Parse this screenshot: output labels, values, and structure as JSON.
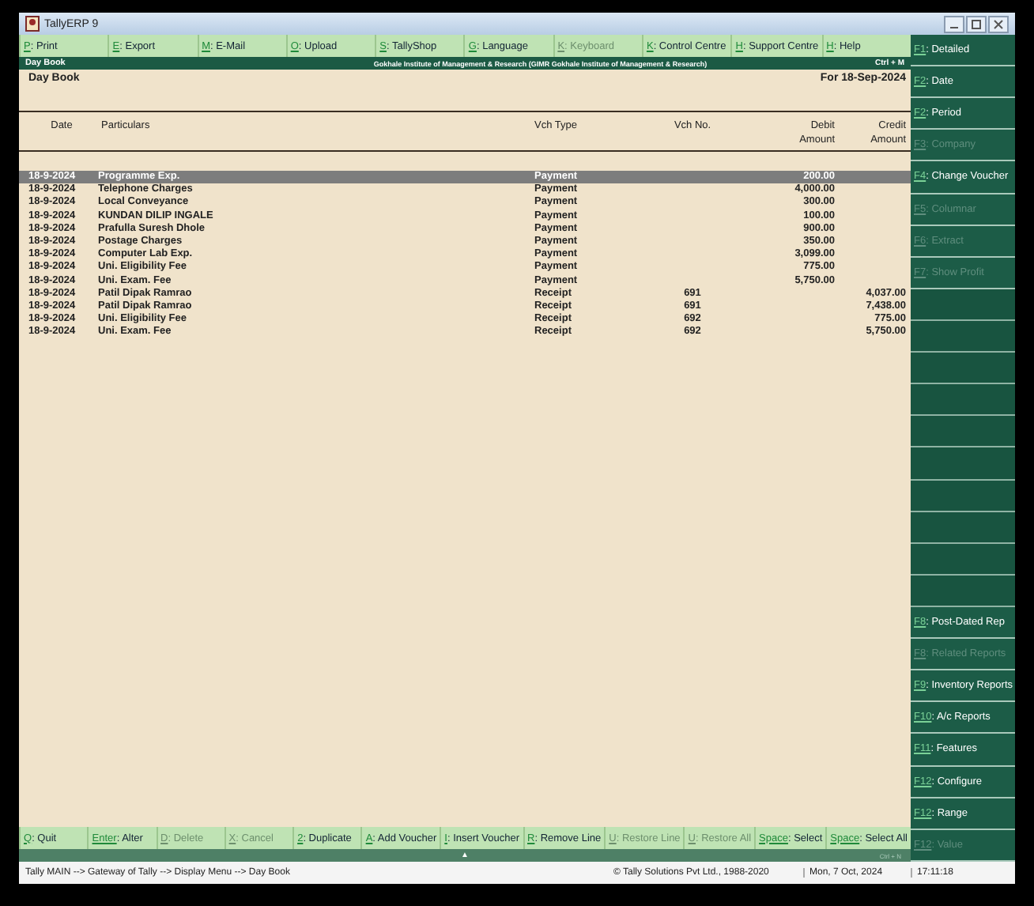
{
  "window": {
    "title": "TallyERP 9"
  },
  "top_buttons": [
    {
      "key": "P",
      "label": ": Print",
      "disabled": false
    },
    {
      "key": "E",
      "label": ": Export",
      "disabled": false
    },
    {
      "key": "M",
      "label": ": E-Mail",
      "disabled": false
    },
    {
      "key": "O",
      "label": ": Upload",
      "disabled": false
    },
    {
      "key": "S",
      "label": ": TallyShop",
      "disabled": false
    },
    {
      "key": "G",
      "label": ": Language",
      "disabled": false
    },
    {
      "key": "K",
      "label": ": Keyboard",
      "disabled": true
    },
    {
      "key": "K",
      "label": ": Control Centre",
      "disabled": false
    },
    {
      "key": "H",
      "label": ": Support Centre",
      "disabled": false
    },
    {
      "key": "H",
      "label": ": Help",
      "disabled": false
    }
  ],
  "header_bar": {
    "screen": "Day Book",
    "company": "Gokhale Institute of Management & Research (GIMR Gokhale Institute of Management & Research)",
    "shortcut": "Ctrl + M"
  },
  "report": {
    "title": "Day Book",
    "period": "For 18-Sep-2024"
  },
  "table": {
    "columns": [
      {
        "label": "Date"
      },
      {
        "label": "Particulars"
      },
      {
        "label": "Vch Type"
      },
      {
        "label": "Vch No."
      },
      {
        "label": "Debit",
        "sub": "Amount"
      },
      {
        "label": "Credit",
        "sub": "Amount"
      }
    ],
    "rows": [
      {
        "date": "18-9-2024",
        "particulars": "Programme Exp.",
        "vch_type": "Payment",
        "debit": "200.00",
        "selected": true
      },
      {
        "date": "18-9-2024",
        "particulars": "Telephone Charges",
        "vch_type": "Payment",
        "debit": "4,000.00",
        "selected": false
      },
      {
        "date": "18-9-2024",
        "particulars": "Local Conveyance",
        "vch_type": "Payment",
        "debit": "300.00",
        "selected": false
      },
      {
        "date": "18-9-2024",
        "particulars": "KUNDAN DILIP INGALE",
        "vch_type": "Payment",
        "debit": "100.00",
        "selected": false
      },
      {
        "date": "18-9-2024",
        "particulars": "Prafulla Suresh Dhole",
        "vch_type": "Payment",
        "debit": "900.00",
        "selected": false
      },
      {
        "date": "18-9-2024",
        "particulars": "Postage Charges",
        "vch_type": "Payment",
        "debit": "350.00",
        "selected": false
      },
      {
        "date": "18-9-2024",
        "particulars": "Computer Lab Exp.",
        "vch_type": "Payment",
        "debit": "3,099.00",
        "selected": false
      },
      {
        "date": "18-9-2024",
        "particulars": "Uni. Eligibility Fee",
        "vch_type": "Payment",
        "debit": "775.00",
        "selected": false
      },
      {
        "date": "18-9-2024",
        "particulars": "Uni. Exam. Fee",
        "vch_type": "Payment",
        "debit": "5,750.00",
        "selected": false
      },
      {
        "date": "18-9-2024",
        "particulars": "Patil Dipak Ramrao",
        "vch_type": "Receipt",
        "vch_no": "691",
        "credit": "4,037.00",
        "selected": false
      },
      {
        "date": "18-9-2024",
        "particulars": "Patil Dipak Ramrao",
        "vch_type": "Receipt",
        "vch_no": "691",
        "credit": "7,438.00",
        "selected": false
      },
      {
        "date": "18-9-2024",
        "particulars": "Uni. Eligibility Fee",
        "vch_type": "Receipt",
        "vch_no": "692",
        "credit": "775.00",
        "selected": false
      },
      {
        "date": "18-9-2024",
        "particulars": "Uni. Exam. Fee",
        "vch_type": "Receipt",
        "vch_no": "692",
        "credit": "5,750.00",
        "selected": false
      }
    ]
  },
  "side_buttons": [
    {
      "key": "F1",
      "label": ": Detailed",
      "disabled": false
    },
    {
      "key": "F2",
      "label": ": Date",
      "disabled": false
    },
    {
      "key": "F2",
      "label": ": Period",
      "disabled": false
    },
    {
      "key": "F3",
      "label": ": Company",
      "disabled": true
    },
    {
      "key": "F4",
      "label": ": Change Voucher",
      "disabled": false
    },
    {
      "key": "F5",
      "label": ": Columnar",
      "disabled": true
    },
    {
      "key": "F6",
      "label": ": Extract",
      "disabled": true
    },
    {
      "key": "F7",
      "label": ": Show Profit",
      "disabled": true
    },
    {
      "kind": "blank"
    },
    {
      "kind": "blank"
    },
    {
      "kind": "blank"
    },
    {
      "kind": "blank"
    },
    {
      "kind": "blank"
    },
    {
      "kind": "blank"
    },
    {
      "kind": "blank"
    },
    {
      "kind": "blank"
    },
    {
      "kind": "blank"
    },
    {
      "kind": "blank"
    },
    {
      "key": "F8",
      "label": ": Post-Dated Rep",
      "disabled": false
    },
    {
      "key": "F8",
      "label": ": Related Reports",
      "disabled": true
    },
    {
      "key": "F9",
      "label": ": Inventory Reports",
      "disabled": false
    },
    {
      "key": "F10",
      "label": ": A/c Reports",
      "disabled": false
    },
    {
      "key": "F11",
      "label": ": Features",
      "disabled": false
    },
    {
      "key": "F12",
      "label": ": Configure",
      "disabled": false
    },
    {
      "key": "F12",
      "label": ": Range",
      "disabled": false
    },
    {
      "key": "F12",
      "label": ": Value",
      "disabled": true
    }
  ],
  "bottom_buttons": [
    {
      "key": "Q",
      "label": ": Quit",
      "disabled": false
    },
    {
      "key": "Enter",
      "label": ": Alter",
      "disabled": false
    },
    {
      "key": "D",
      "label": ": Delete",
      "disabled": true
    },
    {
      "key": "X",
      "label": ": Cancel",
      "disabled": true
    },
    {
      "key": "2",
      "label": ": Duplicate",
      "disabled": false
    },
    {
      "key": "A",
      "label": ": Add Voucher",
      "disabled": false
    },
    {
      "key": "I",
      "label": ": Insert Voucher",
      "disabled": false
    },
    {
      "key": "R",
      "label": ": Remove Line",
      "disabled": false
    },
    {
      "key": "U",
      "label": ": Restore Line",
      "disabled": true
    },
    {
      "key": "U",
      "label": ": Restore All",
      "disabled": true
    },
    {
      "key": "Space",
      "label": ": Select",
      "disabled": false
    },
    {
      "key": "Space",
      "label": ": Select All",
      "disabled": false
    }
  ],
  "bottom_strip": {
    "arrow": "▲",
    "shortcut": "Ctrl + N"
  },
  "status_bar": {
    "path": "Tally MAIN --> Gateway of Tally --> Display Menu --> Day Book",
    "copyright": "© Tally Solutions Pvt Ltd., 1988-2020",
    "date": "Mon, 7 Oct, 2024",
    "time": "17:11:18"
  }
}
